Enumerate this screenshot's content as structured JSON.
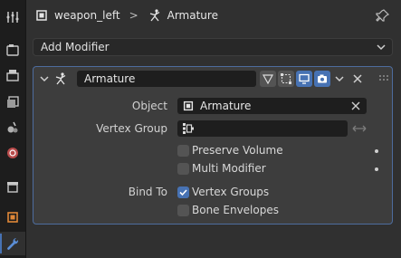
{
  "header": {
    "object_name": "weapon_left",
    "separator": ">",
    "data_name": "Armature"
  },
  "add_modifier": {
    "label": "Add Modifier"
  },
  "modifier": {
    "name": "Armature",
    "object": {
      "label": "Object",
      "value": "Armature"
    },
    "vertex_group": {
      "label": "Vertex Group",
      "value": ""
    },
    "preserve_volume": {
      "label": "Preserve Volume",
      "checked": false
    },
    "multi_modifier": {
      "label": "Multi Modifier",
      "checked": false
    },
    "bind_to": {
      "label": "Bind To",
      "vertex_groups": {
        "label": "Vertex Groups",
        "checked": true
      },
      "bone_envelopes": {
        "label": "Bone Envelopes",
        "checked": false
      }
    }
  },
  "colors": {
    "accent": "#4772b3",
    "panel_border": "#4d6c9e",
    "bg": "#303030"
  }
}
